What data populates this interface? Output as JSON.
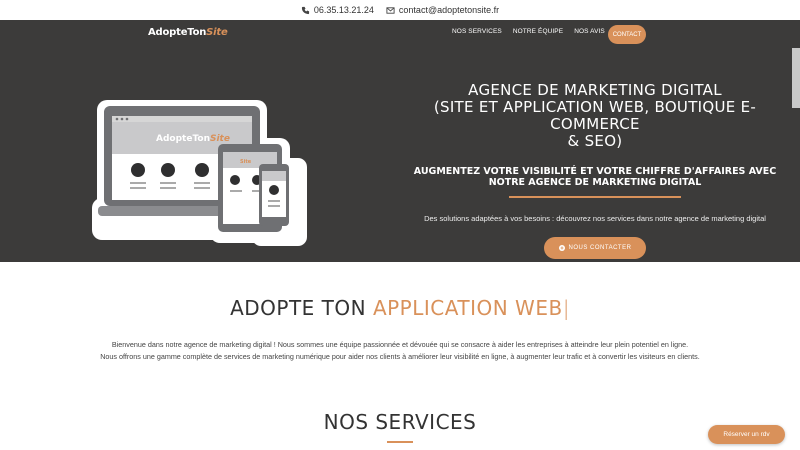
{
  "topbar": {
    "phone": "06.35.13.21.24",
    "email": "contact@adoptetonsite.fr",
    "phone_icon": "phone-icon",
    "email_icon": "envelope-icon"
  },
  "nav": {
    "logo_main": "AdopteTon",
    "logo_accent": "Site",
    "menu": [
      "NOS SERVICES",
      "NOTRE ÉQUIPE",
      "NOS AVIS"
    ],
    "contact_label": "CONTACT"
  },
  "hero": {
    "illustration_logo_main": "AdopteTon",
    "illustration_logo_accent": "Site",
    "title_line1": "AGENCE DE MARKETING DIGITAL",
    "title_line2": "(SITE ET APPLICATION WEB, BOUTIQUE E-COMMERCE",
    "title_line3": "& SEO)",
    "subtitle": "AUGMENTEZ VOTRE VISIBILITÉ ET VOTRE CHIFFRE D'AFFAIRES AVEC NOTRE AGENCE DE MARKETING DIGITAL",
    "description": "Des solutions adaptées à vos besoins : découvrez nos services dans notre agence de marketing digital",
    "cta_label": "NOUS CONTACTER",
    "cta_icon": "plus-circle-icon"
  },
  "intro": {
    "title_main": "ADOPTE TON ",
    "title_accent": "APPLICATION WEB",
    "title_caret": "|",
    "line1": "Bienvenue dans notre agence de marketing digital ! Nous sommes une équipe passionnée et dévouée qui se consacre à aider les entreprises à atteindre leur plein potentiel en ligne.",
    "line2": "Nous offrons une gamme complète de services de marketing numérique pour aider nos clients à améliorer leur visibilité en ligne, à augmenter leur trafic et à convertir les visiteurs en clients."
  },
  "services": {
    "title": "NOS SERVICES"
  },
  "floating": {
    "reserve_label": "Réserver un rdv"
  },
  "colors": {
    "accent": "#d9915a",
    "hero_bg": "#3c3b3a"
  }
}
